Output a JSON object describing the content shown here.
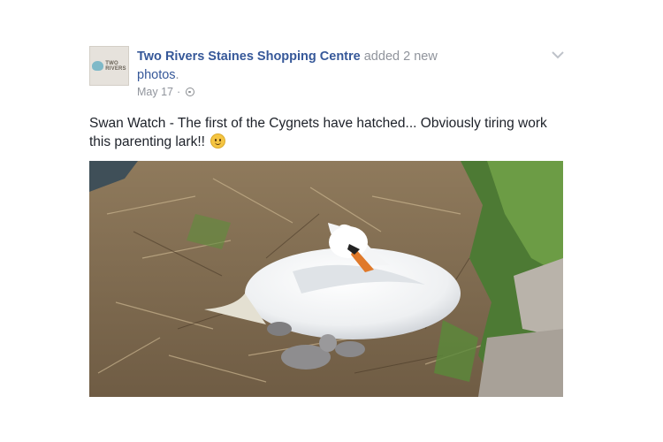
{
  "post": {
    "page_name": "Two Rivers Staines Shopping Centre",
    "action_text": " added 2 new ",
    "action_link": "photos",
    "action_end": ".",
    "date": "May 17",
    "separator": "·",
    "text": "Swan Watch - The first of the Cygnets have hatched... Obviously tiring work this parenting lark!! "
  },
  "avatar": {
    "line1": "TWO",
    "line2": "RIVERS"
  },
  "icons": {
    "audience": "globe-icon",
    "options": "chevron-down-icon",
    "emoji": "smiley-emoji-icon"
  },
  "colors": {
    "link": "#365899",
    "meta": "#90949c",
    "text": "#1d2129"
  }
}
